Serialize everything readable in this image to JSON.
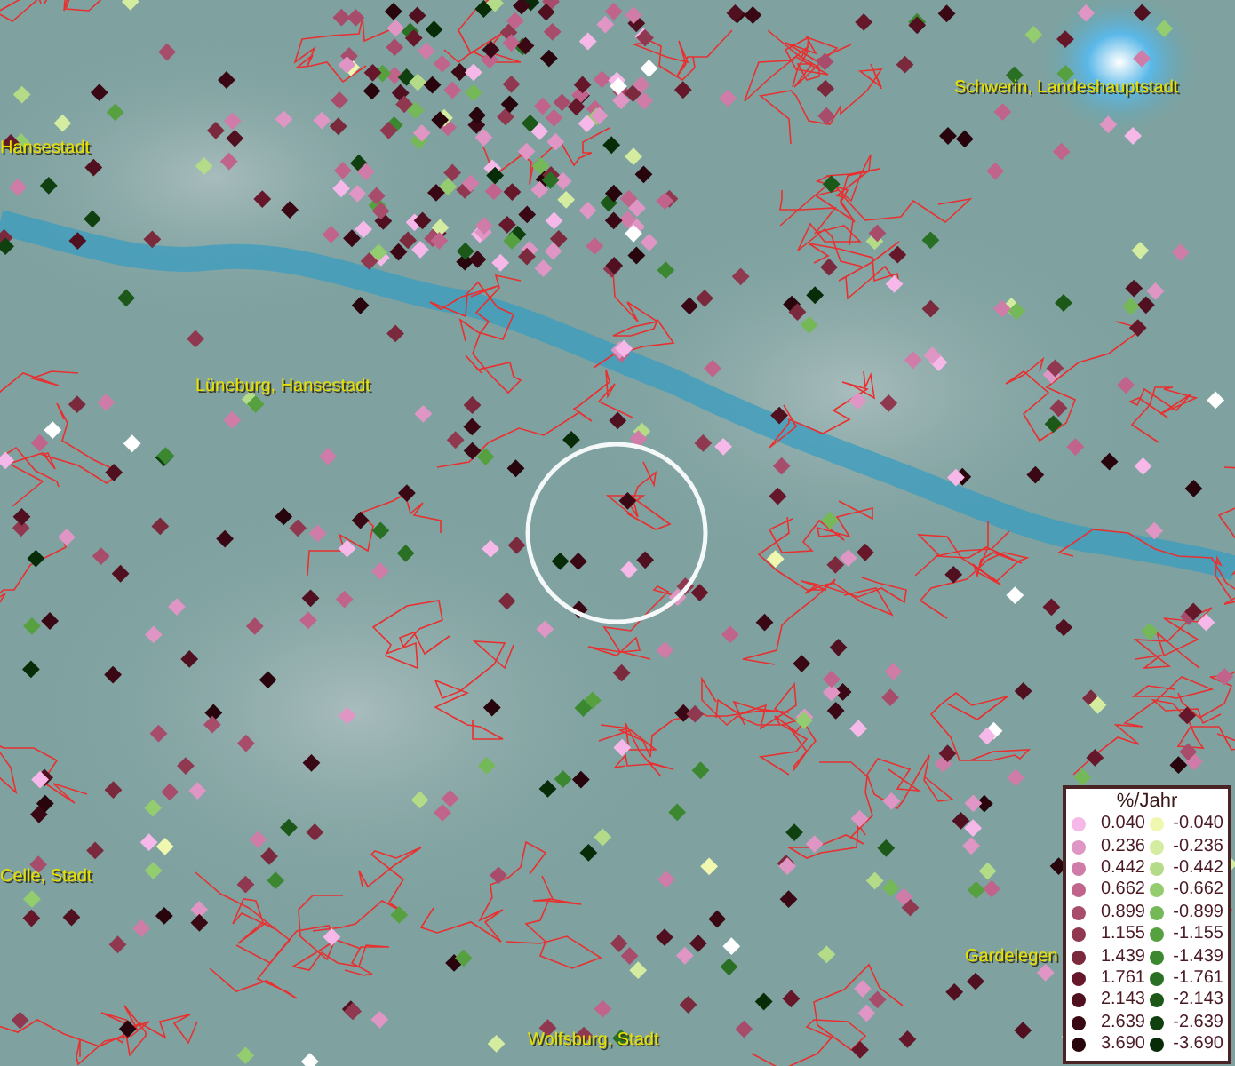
{
  "map": {
    "places": [
      {
        "name": "Hansestadt"
      },
      {
        "name": "Lüneburg, Hansestadt"
      },
      {
        "name": "Schwerin, Landeshauptstadt"
      },
      {
        "name": "Celle, Stadt"
      },
      {
        "name": "Wolfsburg, Stadt"
      },
      {
        "name": "Gardelegen"
      }
    ]
  },
  "legend": {
    "title": "%/Jahr",
    "positive": [
      {
        "value": "0.040",
        "color": "#f5b8e8"
      },
      {
        "value": "0.236",
        "color": "#e096c4"
      },
      {
        "value": "0.442",
        "color": "#d07ca8"
      },
      {
        "value": "0.662",
        "color": "#c0648c"
      },
      {
        "value": "0.899",
        "color": "#a84c6c"
      },
      {
        "value": "1.155",
        "color": "#903850"
      },
      {
        "value": "1.439",
        "color": "#7a2a3c"
      },
      {
        "value": "1.761",
        "color": "#66182a"
      },
      {
        "value": "2.143",
        "color": "#501020"
      },
      {
        "value": "2.639",
        "color": "#3a0814"
      },
      {
        "value": "3.690",
        "color": "#28040c"
      }
    ],
    "negative": [
      {
        "value": "-0.040",
        "color": "#f0f8b0"
      },
      {
        "value": "-0.236",
        "color": "#d4eca0"
      },
      {
        "value": "-0.442",
        "color": "#b4dc88"
      },
      {
        "value": "-0.662",
        "color": "#94cc70"
      },
      {
        "value": "-0.899",
        "color": "#74b858"
      },
      {
        "value": "-1.155",
        "color": "#56a040"
      },
      {
        "value": "-1.439",
        "color": "#3c8830"
      },
      {
        "value": "-1.761",
        "color": "#2a7024"
      },
      {
        "value": "-2.143",
        "color": "#1c5818"
      },
      {
        "value": "-2.639",
        "color": "#104010"
      },
      {
        "value": "-3.690",
        "color": "#082c08"
      }
    ]
  }
}
